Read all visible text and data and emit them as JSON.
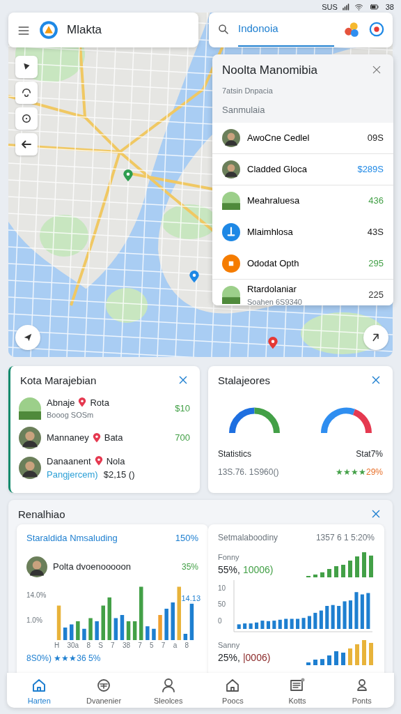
{
  "status_bar": {
    "carrier": "SUS",
    "battery": "38"
  },
  "app_bar": {
    "title": "Mlakta"
  },
  "search": {
    "value": "Indonoia"
  },
  "place_panel": {
    "title": "Noolta Manomibia",
    "subtitle": "7atsin Dnpacia",
    "section": "Sanmulaia",
    "items": [
      {
        "kind": "photo",
        "name": "AwoCne Cedlel",
        "value": "09S",
        "color": "#222222"
      },
      {
        "kind": "photo",
        "name": "Cladded Gloca",
        "value": "$289S",
        "color": "#1e88e5"
      },
      {
        "kind": "scene",
        "name": "Meahraluesa",
        "value": "436",
        "color": "#43a047"
      },
      {
        "kind": "pin",
        "name": "Mlaimhlosa",
        "value": "43S",
        "color": "#222222"
      },
      {
        "kind": "tag",
        "name": "Ododat Opth",
        "value": "295",
        "color": "#43a047"
      },
      {
        "kind": "scene",
        "name": "Rtardolaniar",
        "detail": "Soahen 6S9340",
        "value": "225",
        "color": "#333333"
      }
    ]
  },
  "city_card": {
    "title": "Kota Marajebian",
    "rows": [
      {
        "name": "Abnaje",
        "place": "Rota",
        "value": "$10",
        "detail": "Booog SOSm"
      },
      {
        "name": "Mannaney",
        "place": "Bata",
        "value": "700"
      },
      {
        "name": "Danaanent",
        "place": "Nola",
        "link": "Pangjercem)",
        "amount": "$2,15 ()"
      }
    ]
  },
  "stats_card": {
    "title": "Stalajeores",
    "gauges": [
      {
        "level": 0.5,
        "label": "Statistics",
        "reading": "13S.76. 1S960()"
      },
      {
        "level": 0.65,
        "label": "Stat7%",
        "stars": 4,
        "reading": "29%"
      }
    ]
  },
  "report_card": {
    "title": "Renalhiao",
    "left": {
      "title": "Staraldida Nmsaluding",
      "value": "150%",
      "person": "Polta dvoenooooon",
      "person_value": "35%",
      "marker": "14.13",
      "y_labels": [
        "14.0%",
        "1.0%"
      ],
      "x_labels": [
        "H",
        "30a",
        "8",
        "S",
        "7",
        "38",
        "7",
        "5",
        "7",
        "a",
        "8"
      ],
      "footer": "8S0%) ★★★36 5%"
    },
    "right": {
      "title": "Setmalaboodiny",
      "value": "1357 6 1 5:20%",
      "top": {
        "label": "Fonny",
        "value": "55%,",
        "detail": "10006)"
      },
      "y_labels": [
        "10",
        "50",
        "0"
      ],
      "bottom": {
        "label": "Sanny",
        "value": "25%,",
        "detail": "|0006)"
      }
    }
  },
  "bottom_nav": [
    {
      "label": "Harten",
      "selected": true
    },
    {
      "label": "Dvanenier",
      "selected": false
    },
    {
      "label": "Sleolces",
      "selected": false
    },
    {
      "label": "Poocs",
      "selected": false
    },
    {
      "label": "Kotts",
      "selected": false
    },
    {
      "label": "Ponts",
      "selected": false
    }
  ]
}
